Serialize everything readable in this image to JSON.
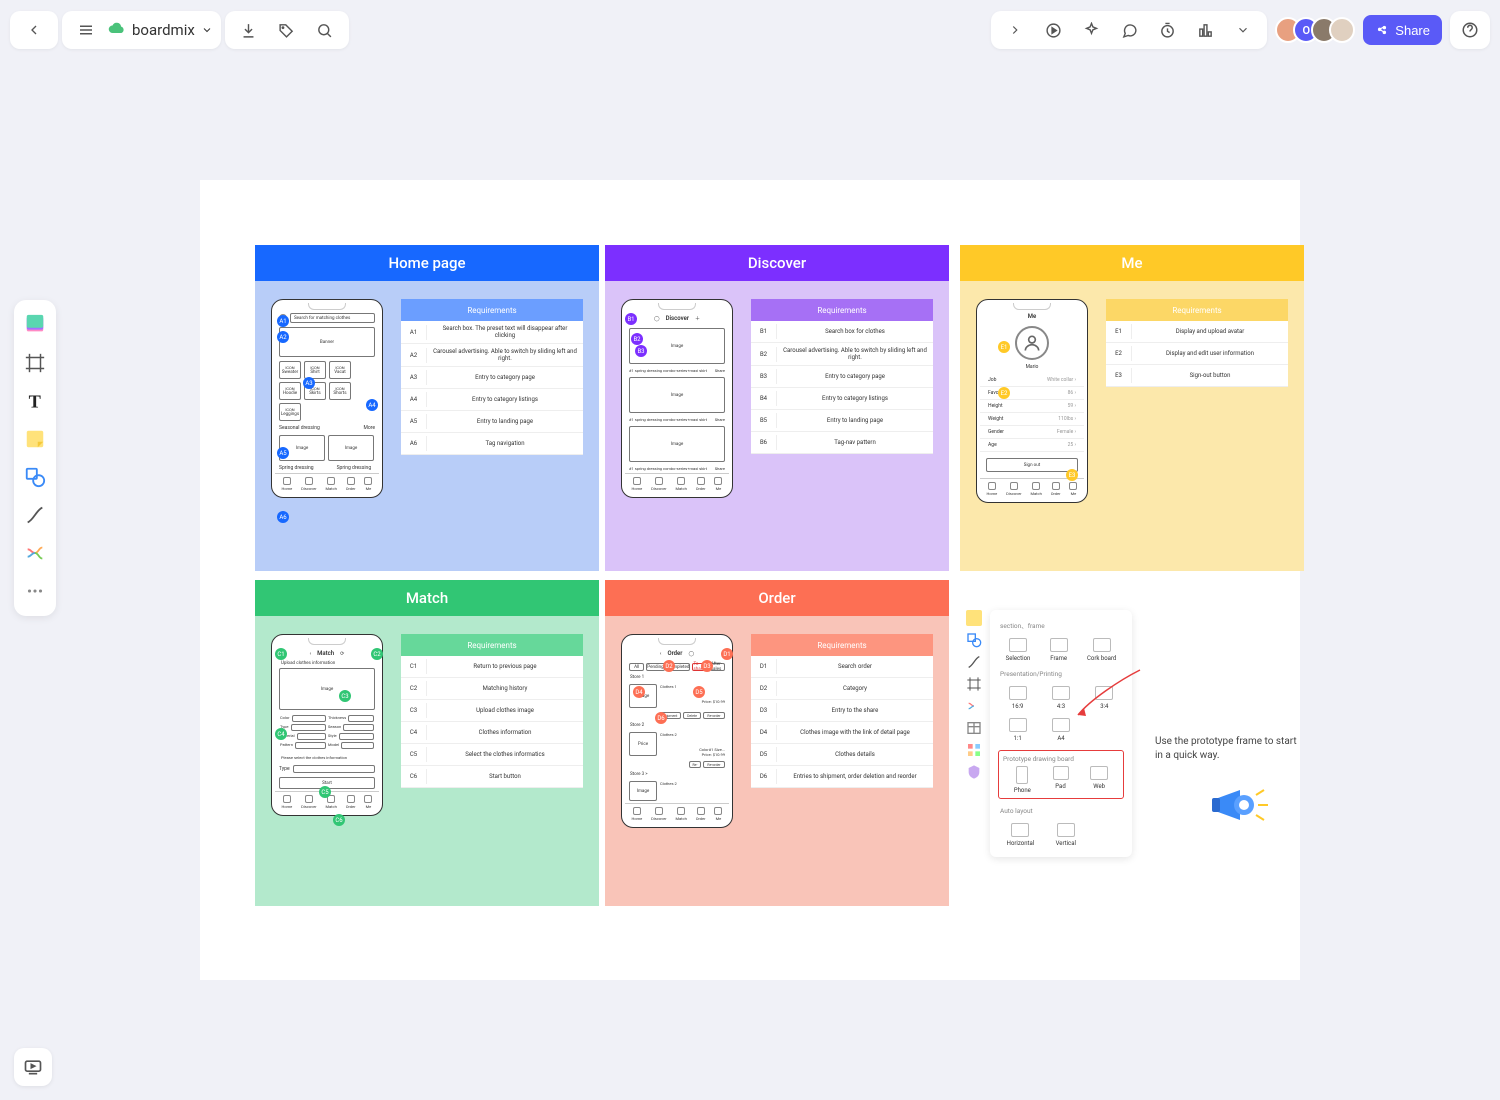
{
  "header": {
    "brand": "boardmix",
    "share_label": "Share"
  },
  "toolbar": {
    "items": [
      "templates",
      "frame",
      "text",
      "note",
      "shapes",
      "connector",
      "mindmap",
      "more"
    ]
  },
  "cards": {
    "home": {
      "title": "Home page",
      "req_title": "Requirements",
      "rows": [
        {
          "id": "A1",
          "text": "Search box. The preset text will disappear after clicking"
        },
        {
          "id": "A2",
          "text": "Carousel advertising. Able to switch by sliding left and right."
        },
        {
          "id": "A3",
          "text": "Entry to category page"
        },
        {
          "id": "A4",
          "text": "Entry to category listings"
        },
        {
          "id": "A5",
          "text": "Entry to landing page"
        },
        {
          "id": "A6",
          "text": "Tag navigation"
        }
      ],
      "phone": {
        "search_ph": "Search for matching clothes",
        "banner": "Banner",
        "icons": [
          "Sweater",
          "Shirt",
          "Vacat",
          "Hoodie"
        ],
        "icons2": [
          "Skirts",
          "Shorts",
          "Leggings"
        ],
        "section": "Seasonal dressing",
        "more": "More",
        "spring": "Spring dressing",
        "tabs": [
          "Home",
          "Discover",
          "Match",
          "Order",
          "Me"
        ]
      }
    },
    "discover": {
      "title": "Discover",
      "req_title": "Requirements",
      "rows": [
        {
          "id": "B1",
          "text": "Search box for clothes"
        },
        {
          "id": "B2",
          "text": "Carousel advertising. Able to switch by sliding left and right."
        },
        {
          "id": "B3",
          "text": "Entry to category page"
        },
        {
          "id": "B4",
          "text": "Entry to category listings"
        },
        {
          "id": "B5",
          "text": "Entry to landing page"
        },
        {
          "id": "B6",
          "text": "Tag-nav pattern"
        }
      ],
      "phone": {
        "title": "Discover",
        "image": "Image",
        "caption": "#1 spring dressing combo-series+maxi skirt",
        "share": "Share",
        "tabs": [
          "Home",
          "Discover",
          "Match",
          "Order",
          "Me"
        ]
      }
    },
    "me": {
      "title": "Me",
      "req_title": "Requirements",
      "rows": [
        {
          "id": "E1",
          "text": "Display and upload avatar"
        },
        {
          "id": "E2",
          "text": "Display and edit user information"
        },
        {
          "id": "E3",
          "text": "Sign-out button"
        }
      ],
      "phone": {
        "title": "Me",
        "name": "Mario",
        "fields": [
          {
            "k": "Job",
            "v": "White collar"
          },
          {
            "k": "Favorites",
            "v": "86"
          },
          {
            "k": "Height",
            "v": "59"
          },
          {
            "k": "Weight",
            "v": "110lbs"
          },
          {
            "k": "Gender",
            "v": "Female"
          },
          {
            "k": "Age",
            "v": "25"
          }
        ],
        "signout": "Sign out",
        "tabs": [
          "Home",
          "Discover",
          "Match",
          "Order",
          "Me"
        ]
      }
    },
    "match": {
      "title": "Match",
      "req_title": "Requirements",
      "rows": [
        {
          "id": "C1",
          "text": "Return to previous page"
        },
        {
          "id": "C2",
          "text": "Matching history"
        },
        {
          "id": "C3",
          "text": "Upload clothes image"
        },
        {
          "id": "C4",
          "text": "Clothes information"
        },
        {
          "id": "C5",
          "text": "Select the clothes informatics"
        },
        {
          "id": "C6",
          "text": "Start button"
        }
      ],
      "phone": {
        "title": "Match",
        "upload": "Upload clothes information",
        "image": "Image",
        "labels": [
          {
            "k": "Color",
            "v": ""
          },
          {
            "k": "Thickness",
            "v": ""
          },
          {
            "k": "Type",
            "v": ""
          },
          {
            "k": "Season",
            "v": ""
          },
          {
            "k": "Material",
            "v": ""
          },
          {
            "k": "Style",
            "v": ""
          },
          {
            "k": "Pattern",
            "v": ""
          },
          {
            "k": "Model",
            "v": ""
          }
        ],
        "prompt": "Please select the clothes information",
        "type_lbl": "Type",
        "start": "Start",
        "tabs": [
          "Home",
          "Discover",
          "Match",
          "Order",
          "Me"
        ]
      }
    },
    "order": {
      "title": "Order",
      "req_title": "Requirements",
      "rows": [
        {
          "id": "D1",
          "text": "Search order"
        },
        {
          "id": "D2",
          "text": "Category"
        },
        {
          "id": "D3",
          "text": "Entry to the share"
        },
        {
          "id": "D4",
          "text": "Clothes image with the link of detail page"
        },
        {
          "id": "D5",
          "text": "Clothes details"
        },
        {
          "id": "D6",
          "text": "Entries to shipment, order deletion and reorder"
        }
      ],
      "phone": {
        "title": "Order",
        "tabs_top": [
          "All",
          "Pending",
          "Completed",
          "To share",
          "After-sales"
        ],
        "store": "Store 1",
        "clothes": "Clothes 1",
        "image": "Image",
        "price": "Price: $10.99",
        "btns": [
          "Shipment",
          "Delete",
          "Re-order"
        ],
        "price2": "Price",
        "tabs": [
          "Home",
          "Discover",
          "Match",
          "Order",
          "Me"
        ]
      }
    }
  },
  "hint": {
    "s1": "section、frame",
    "r1": [
      "Selection",
      "Frame",
      "Cork board"
    ],
    "s2": "Presentation/Printing",
    "r2": [
      "16:9",
      "4:3",
      "3:4"
    ],
    "r3": [
      "1:1",
      "A4",
      ""
    ],
    "s3": "Prototype drawing board",
    "r4": [
      "Phone",
      "Pad",
      "Web"
    ],
    "s4": "Auto layout",
    "r5": [
      "Horizontal",
      "Vertical",
      ""
    ],
    "text": "Use the prototype frame to start in a quick way."
  }
}
